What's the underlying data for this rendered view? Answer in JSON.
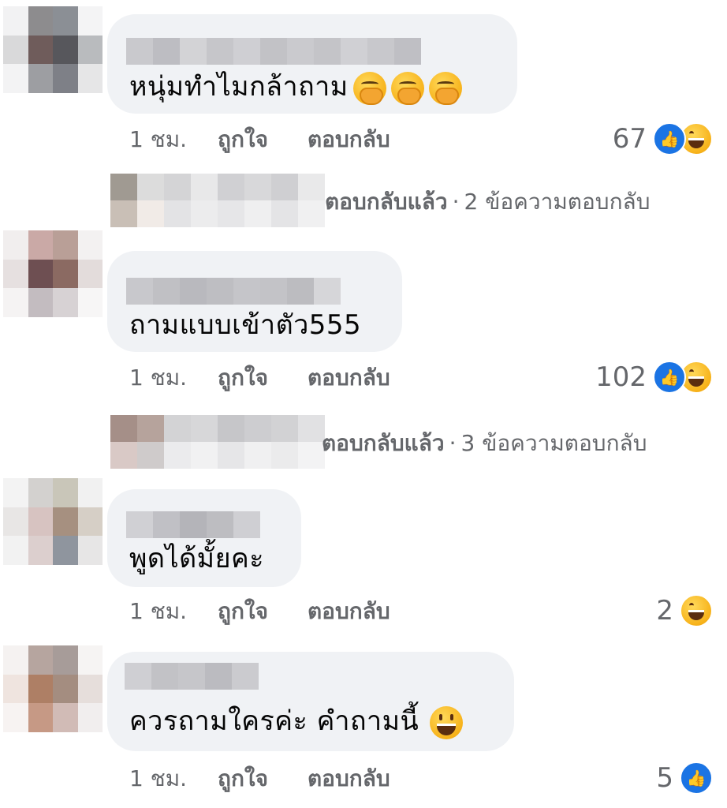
{
  "comments": [
    {
      "text": "หนุ่มทำไมกล้าถาม",
      "emoji": [
        "hand-over-mouth-emoji",
        "hand-over-mouth-emoji",
        "hand-over-mouth-emoji"
      ],
      "time": "1 ชม.",
      "like_label": "ถูกใจ",
      "reply_label": "ตอบกลับ",
      "reaction_count": "67",
      "reactions": [
        "like-icon",
        "haha-icon"
      ],
      "replies": {
        "label": "ตอบกลับแล้ว",
        "separator": "·",
        "count_text": "2 ข้อความตอบกลับ"
      }
    },
    {
      "text": "ถามแบบเข้าตัว555",
      "time": "1 ชม.",
      "like_label": "ถูกใจ",
      "reply_label": "ตอบกลับ",
      "reaction_count": "102",
      "reactions": [
        "like-icon",
        "haha-icon"
      ],
      "replies": {
        "label": "ตอบกลับแล้ว",
        "separator": "·",
        "count_text": "3 ข้อความตอบกลับ"
      }
    },
    {
      "text": "พูดได้มั้ยคะ",
      "time": "1 ชม.",
      "like_label": "ถูกใจ",
      "reply_label": "ตอบกลับ",
      "reaction_count": "2",
      "reactions": [
        "haha-icon"
      ]
    },
    {
      "text": "ควรถามใครค่ะ คำถามนี้",
      "emoji": [
        "grinning-face-emoji"
      ],
      "time": "1 ชม.",
      "like_label": "ถูกใจ",
      "reply_label": "ตอบกลับ",
      "reaction_count": "5",
      "reactions": [
        "like-icon"
      ]
    }
  ],
  "colors": {
    "bubble": "#f0f2f5",
    "meta_text": "#65676b",
    "like_blue": "#1b74e4",
    "haha_yellow": "#f7b21a"
  }
}
